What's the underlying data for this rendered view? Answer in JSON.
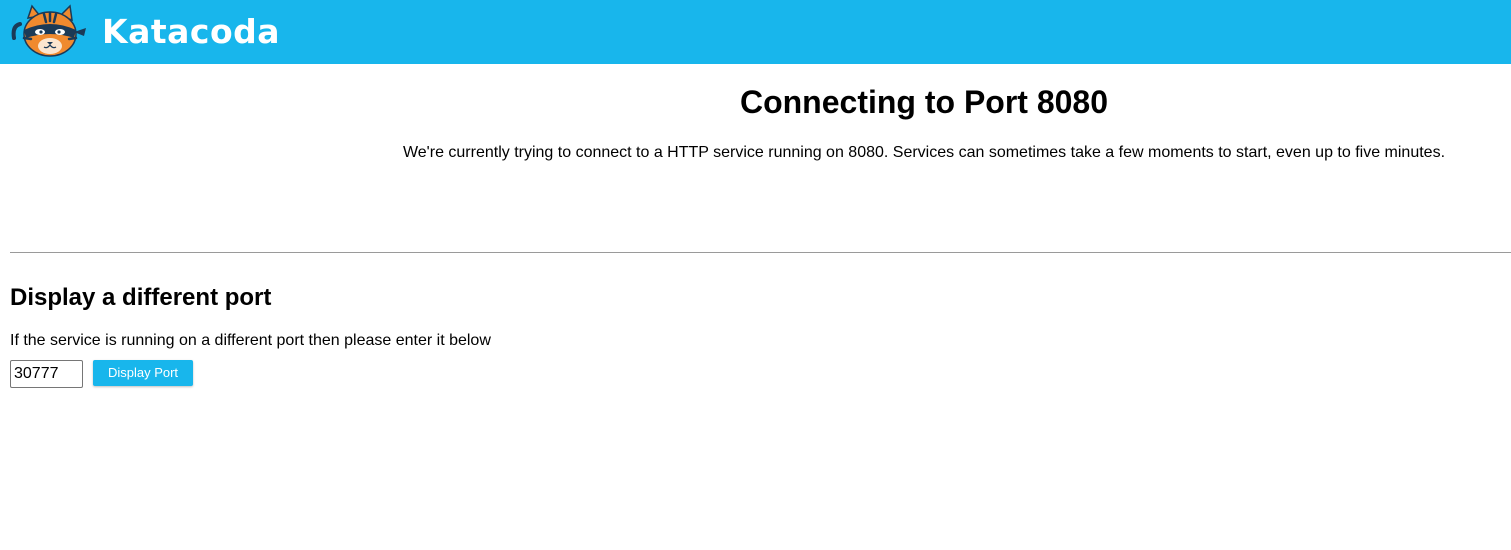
{
  "header": {
    "logo_text": "Katacoda",
    "logo_icon": "katacoda-cat-logo-icon",
    "background_color": "#18b6ec"
  },
  "main": {
    "title": "Connecting to Port 8080",
    "description": "We're currently trying to connect to a HTTP service running on 8080. Services can sometimes take a few moments to start, even up to five minutes."
  },
  "port_section": {
    "title": "Display a different port",
    "description": "If the service is running on a different port then please enter it below",
    "input_value": "30777",
    "button_label": "Display Port",
    "button_color": "#18b6ec"
  }
}
